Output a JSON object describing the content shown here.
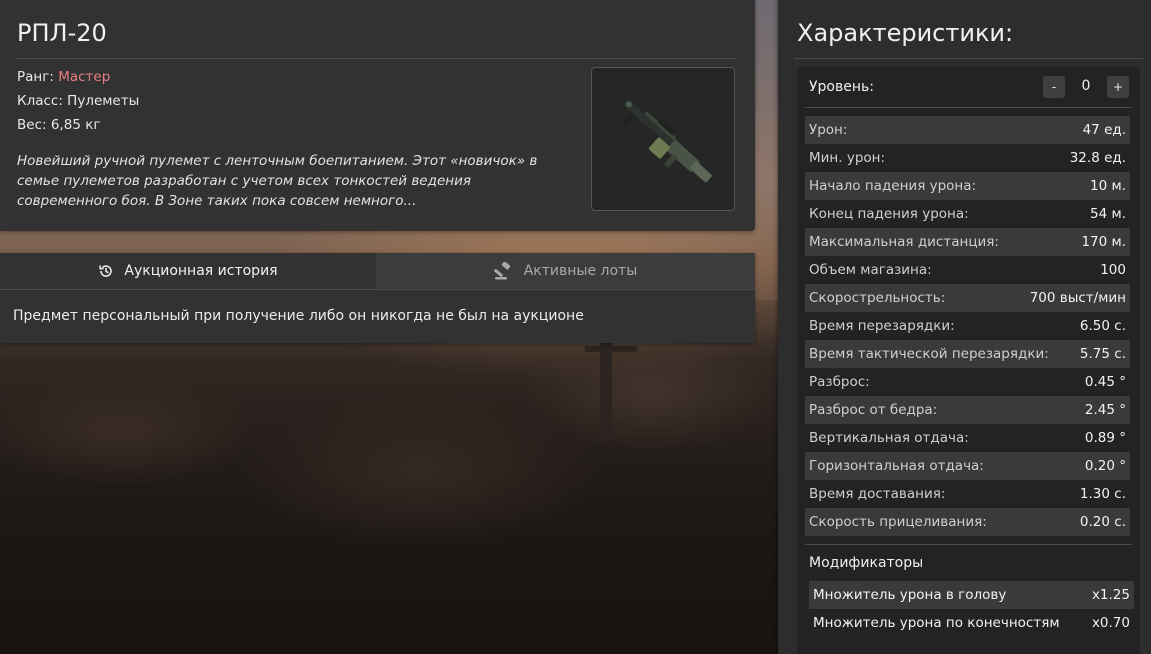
{
  "item": {
    "title": "РПЛ-20",
    "rank_label": "Ранг: ",
    "rank_value": "Мастер",
    "class_label": "Класс: ",
    "class_value": "Пулеметы",
    "weight_label": "Вес: ",
    "weight_value": "6,85 кг",
    "description": "Новейший ручной пулемет с ленточным боепитанием. Этот «новичок» в семье пулеметов разработан с учетом всех тонкостей ведения современного боя. В Зоне таких пока совсем немного..."
  },
  "auction": {
    "tabs": [
      {
        "label": "Аукционная история",
        "icon": "history-icon",
        "active": true
      },
      {
        "label": "Активные лоты",
        "icon": "gavel-icon",
        "active": false
      }
    ],
    "message": "Предмет персональный при получение либо он никогда не был на аукционе"
  },
  "stats": {
    "title": "Характеристики:",
    "level_label": "Уровень:",
    "level_minus": "-",
    "level_value": "0",
    "level_plus": "+",
    "rows": [
      {
        "label": "Урон:",
        "value": "47 ед."
      },
      {
        "label": "Мин. урон:",
        "value": "32.8 ед."
      },
      {
        "label": "Начало падения урона:",
        "value": "10 м."
      },
      {
        "label": "Конец падения урона:",
        "value": "54 м."
      },
      {
        "label": "Максимальная дистанция:",
        "value": "170 м."
      },
      {
        "label": "Объем магазина:",
        "value": "100"
      },
      {
        "label": "Скорострельность:",
        "value": "700 выст/мин"
      },
      {
        "label": "Время перезарядки:",
        "value": "6.50 с."
      },
      {
        "label": "Время тактической перезарядки:",
        "value": "5.75 с."
      },
      {
        "label": "Разброс:",
        "value": "0.45 °"
      },
      {
        "label": "Разброс от бедра:",
        "value": "2.45 °"
      },
      {
        "label": "Вертикальная отдача:",
        "value": "0.89 °"
      },
      {
        "label": "Горизонтальная отдача:",
        "value": "0.20 °"
      },
      {
        "label": "Время доставания:",
        "value": "1.30 с."
      },
      {
        "label": "Скорость прицеливания:",
        "value": "0.20 с."
      }
    ],
    "modifiers_title": "Модификаторы",
    "modifiers": [
      {
        "label": "Множитель урона в голову",
        "value": "x1.25"
      },
      {
        "label": "Множитель урона по конечностям",
        "value": "x0.70"
      }
    ]
  },
  "colors": {
    "rank_master": "#e77f7f",
    "panel": "#323232",
    "stats_box": "#232323"
  }
}
